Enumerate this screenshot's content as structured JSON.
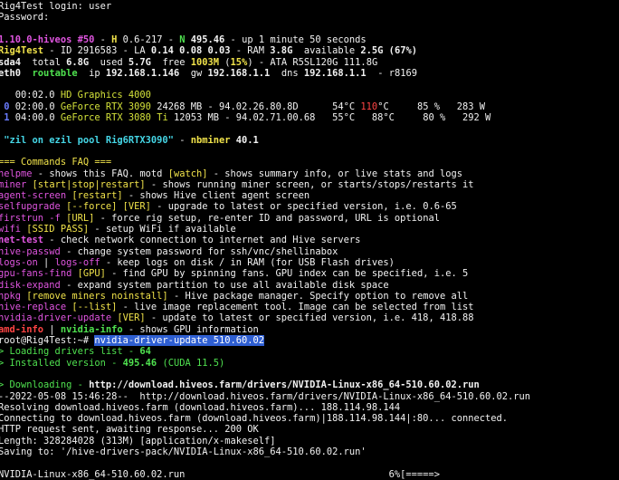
{
  "lines": [
    {
      "y": 0,
      "segs": [
        {
          "t": "Rig4Test login: user",
          "c": "w"
        }
      ]
    },
    {
      "y": 1,
      "segs": [
        {
          "t": "Password:",
          "c": "w"
        }
      ]
    },
    {
      "y": 2,
      "segs": [
        {
          "t": "",
          "c": "w"
        }
      ]
    },
    {
      "y": 3,
      "segs": [
        {
          "t": "1.10.0-hiveos #50",
          "c": "m b"
        },
        {
          "t": " - ",
          "c": "w"
        },
        {
          "t": "H",
          "c": "y b"
        },
        {
          "t": " 0.6-217 - ",
          "c": "w"
        },
        {
          "t": "N",
          "c": "g b"
        },
        {
          "t": " 495.46",
          "c": "w b"
        },
        {
          "t": " - up 1 minute 50 seconds",
          "c": "w"
        }
      ]
    },
    {
      "y": 4,
      "segs": [
        {
          "t": "Rig4Test",
          "c": "y b"
        },
        {
          "t": " - ID 2916583 - LA ",
          "c": "w"
        },
        {
          "t": "0.14 0.08 0.03",
          "c": "w b"
        },
        {
          "t": " - RAM ",
          "c": "w"
        },
        {
          "t": "3.8G",
          "c": "w b"
        },
        {
          "t": "  available ",
          "c": "w"
        },
        {
          "t": "2.5G (67%)",
          "c": "w b"
        }
      ]
    },
    {
      "y": 5,
      "segs": [
        {
          "t": "sda4",
          "c": "w b"
        },
        {
          "t": "  total ",
          "c": "w"
        },
        {
          "t": "6.8G",
          "c": "w b"
        },
        {
          "t": "  used ",
          "c": "w"
        },
        {
          "t": "5.7G",
          "c": "w b"
        },
        {
          "t": "  free ",
          "c": "w"
        },
        {
          "t": "1003M",
          "c": "y b"
        },
        {
          "t": " (",
          "c": "w"
        },
        {
          "t": "15%",
          "c": "y b"
        },
        {
          "t": ")",
          "c": "w"
        },
        {
          "t": " - ATA R5SL120G 111.8G",
          "c": "w"
        }
      ]
    },
    {
      "y": 6,
      "segs": [
        {
          "t": "eth0",
          "c": "w b"
        },
        {
          "t": "  ",
          "c": "w"
        },
        {
          "t": "routable",
          "c": "g b"
        },
        {
          "t": "  ip ",
          "c": "w"
        },
        {
          "t": "192.168.1.146",
          "c": "w b"
        },
        {
          "t": "  gw ",
          "c": "w"
        },
        {
          "t": "192.168.1.1",
          "c": "w b"
        },
        {
          "t": "  dns ",
          "c": "w"
        },
        {
          "t": "192.168.1.1",
          "c": "w b"
        },
        {
          "t": "  - r8169",
          "c": "w"
        }
      ]
    },
    {
      "y": 7,
      "segs": [
        {
          "t": "",
          "c": "w"
        }
      ]
    },
    {
      "y": 8,
      "segs": [
        {
          "t": "   00:02.0 ",
          "c": "w"
        },
        {
          "t": "HD Graphics 4000",
          "c": "gy"
        }
      ]
    },
    {
      "y": 9,
      "segs": [
        {
          "t": " ",
          "c": "w"
        },
        {
          "t": "0",
          "c": "bl b"
        },
        {
          "t": " 02:00.0 ",
          "c": "w"
        },
        {
          "t": "GeForce RTX 3090",
          "c": "gy"
        },
        {
          "t": " 24268 MB - 94.02.26.80.8D      54°C ",
          "c": "w"
        },
        {
          "t": "110",
          "c": "r"
        },
        {
          "t": "°C     85 %   283 W",
          "c": "w"
        }
      ]
    },
    {
      "y": 10,
      "segs": [
        {
          "t": " ",
          "c": "w"
        },
        {
          "t": "1",
          "c": "bl b"
        },
        {
          "t": " 04:00.0 ",
          "c": "w"
        },
        {
          "t": "GeForce RTX 3080 Ti",
          "c": "gy"
        },
        {
          "t": " 12053 MB - 94.02.71.00.68   55°C   88°C     80 %   292 W",
          "c": "w"
        }
      ]
    },
    {
      "y": 11,
      "segs": [
        {
          "t": "",
          "c": "w"
        }
      ]
    },
    {
      "y": 12,
      "segs": [
        {
          "t": " \"zil on ezil pool Rig6RTX3090\"",
          "c": "c b"
        },
        {
          "t": " - ",
          "c": "w"
        },
        {
          "t": "nbminer",
          "c": "y b"
        },
        {
          "t": " 40.1",
          "c": "w b"
        }
      ]
    },
    {
      "y": 13,
      "segs": [
        {
          "t": "",
          "c": "w"
        }
      ]
    },
    {
      "y": 14,
      "segs": [
        {
          "t": "=== Commands FAQ ===",
          "c": "y"
        }
      ]
    },
    {
      "y": 15,
      "segs": [
        {
          "t": "helpme",
          "c": "m"
        },
        {
          "t": " - shows this FAQ. motd ",
          "c": "w"
        },
        {
          "t": "[watch]",
          "c": "y"
        },
        {
          "t": " - shows summary info, or live stats and logs",
          "c": "w"
        }
      ]
    },
    {
      "y": 16,
      "segs": [
        {
          "t": "miner ",
          "c": "m"
        },
        {
          "t": "[start|stop|restart]",
          "c": "y"
        },
        {
          "t": " - shows running miner screen, or starts/stops/restarts it",
          "c": "w"
        }
      ]
    },
    {
      "y": 17,
      "segs": [
        {
          "t": "agent-screen ",
          "c": "m"
        },
        {
          "t": "[restart]",
          "c": "y"
        },
        {
          "t": " - shows Hive client agent screen",
          "c": "w"
        }
      ]
    },
    {
      "y": 18,
      "segs": [
        {
          "t": "selfupgrade ",
          "c": "m"
        },
        {
          "t": "[--force] [VER]",
          "c": "y"
        },
        {
          "t": " - upgrade to latest or specified version, i.e. 0.6-65",
          "c": "w"
        }
      ]
    },
    {
      "y": 19,
      "segs": [
        {
          "t": "firstrun -f ",
          "c": "m"
        },
        {
          "t": "[URL]",
          "c": "y"
        },
        {
          "t": " - force rig setup, re-enter ID and password, URL is optional",
          "c": "w"
        }
      ]
    },
    {
      "y": 20,
      "segs": [
        {
          "t": "wifi ",
          "c": "m"
        },
        {
          "t": "[SSID PASS]",
          "c": "y"
        },
        {
          "t": " - setup WiFi if available",
          "c": "w"
        }
      ]
    },
    {
      "y": 21,
      "segs": [
        {
          "t": "net-test",
          "c": "m b"
        },
        {
          "t": " - check network connection to internet and Hive servers",
          "c": "w"
        }
      ]
    },
    {
      "y": 22,
      "segs": [
        {
          "t": "hive-passwd",
          "c": "m"
        },
        {
          "t": " - change system password for ssh/vnc/shellinabox",
          "c": "w"
        }
      ]
    },
    {
      "y": 23,
      "segs": [
        {
          "t": "logs-on",
          "c": "m"
        },
        {
          "t": " | ",
          "c": "w"
        },
        {
          "t": "logs-off",
          "c": "m"
        },
        {
          "t": " - keep logs on disk / in RAM (for USB Flash drives)",
          "c": "w"
        }
      ]
    },
    {
      "y": 24,
      "segs": [
        {
          "t": "gpu-fans-find ",
          "c": "m"
        },
        {
          "t": "[GPU]",
          "c": "y"
        },
        {
          "t": " - find GPU by spinning fans. GPU index can be specified, i.e. 5",
          "c": "w"
        }
      ]
    },
    {
      "y": 25,
      "segs": [
        {
          "t": "disk-expand",
          "c": "m"
        },
        {
          "t": " - expand system partition to use all available disk space",
          "c": "w"
        }
      ]
    },
    {
      "y": 26,
      "segs": [
        {
          "t": "hpkg ",
          "c": "m"
        },
        {
          "t": "[remove miners noinstall]",
          "c": "y"
        },
        {
          "t": " - Hive package manager. Specify option to remove all",
          "c": "w"
        }
      ]
    },
    {
      "y": 27,
      "segs": [
        {
          "t": "hive-replace ",
          "c": "m"
        },
        {
          "t": "[--list]",
          "c": "y"
        },
        {
          "t": " - live image replacement tool. Image can be selected from list",
          "c": "w"
        }
      ]
    },
    {
      "y": 28,
      "segs": [
        {
          "t": "nvidia-driver-update ",
          "c": "m"
        },
        {
          "t": "[VER]",
          "c": "y"
        },
        {
          "t": " - update to latest or specified version, i.e. 418, 418.88",
          "c": "w"
        }
      ]
    },
    {
      "y": 29,
      "segs": [
        {
          "t": "amd-info",
          "c": "r b"
        },
        {
          "t": " | ",
          "c": "w"
        },
        {
          "t": "nvidia-info",
          "c": "g b"
        },
        {
          "t": " - shows GPU information",
          "c": "w"
        }
      ]
    },
    {
      "y": 30,
      "segs": [
        {
          "t": "root@Rig4Test:~# ",
          "c": "w"
        },
        {
          "t": "nvidia-driver-update 510.60.02",
          "c": "sel"
        }
      ]
    },
    {
      "y": 31,
      "segs": [
        {
          "t": "> Loading drivers list - ",
          "c": "g"
        },
        {
          "t": "64",
          "c": "g b"
        }
      ]
    },
    {
      "y": 32,
      "segs": [
        {
          "t": "> Installed version - ",
          "c": "g"
        },
        {
          "t": "495.46",
          "c": "g b"
        },
        {
          "t": " (CUDA 11.5)",
          "c": "g"
        }
      ]
    },
    {
      "y": 33,
      "segs": [
        {
          "t": "",
          "c": "w"
        }
      ]
    },
    {
      "y": 34,
      "segs": [
        {
          "t": "> Downloading - ",
          "c": "g"
        },
        {
          "t": "http://download.hiveos.farm/drivers/NVIDIA-Linux-x86_64-510.60.02.run",
          "c": "w b"
        }
      ]
    },
    {
      "y": 35,
      "segs": [
        {
          "t": "--2022-05-08 15:46:28--  http://download.hiveos.farm/drivers/NVIDIA-Linux-x86_64-510.60.02.run",
          "c": "w"
        }
      ]
    },
    {
      "y": 36,
      "segs": [
        {
          "t": "Resolving download.hiveos.farm (download.hiveos.farm)... 188.114.98.144",
          "c": "w"
        }
      ]
    },
    {
      "y": 37,
      "segs": [
        {
          "t": "Connecting to download.hiveos.farm (download.hiveos.farm)|188.114.98.144|:80... connected.",
          "c": "w"
        }
      ]
    },
    {
      "y": 38,
      "segs": [
        {
          "t": "HTTP request sent, awaiting response... 200 OK",
          "c": "w"
        }
      ]
    },
    {
      "y": 39,
      "segs": [
        {
          "t": "Length: 328284028 (313M) [application/x-makeself]",
          "c": "w"
        }
      ]
    },
    {
      "y": 40,
      "segs": [
        {
          "t": "Saving to: '/hive-drivers-pack/NVIDIA-Linux-x86_64-510.60.02.run'",
          "c": "w"
        }
      ]
    },
    {
      "y": 41,
      "segs": [
        {
          "t": "",
          "c": "w"
        }
      ]
    },
    {
      "y": 42,
      "segs": [
        {
          "t": "NVIDIA-Linux-x86_64-510.60.02.run                                    6%[=====>",
          "c": "w"
        }
      ]
    }
  ]
}
